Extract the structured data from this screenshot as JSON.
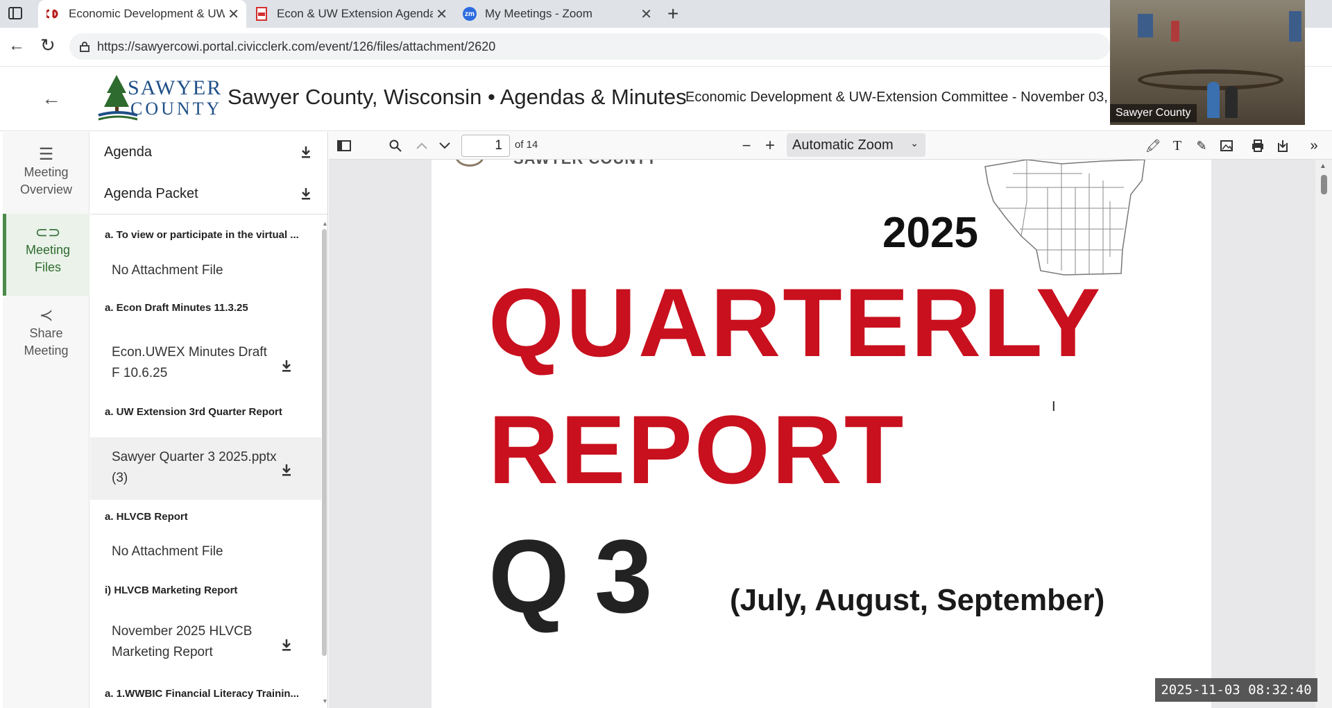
{
  "browser": {
    "tabs": [
      {
        "title": "Economic Development & UW-Ex"
      },
      {
        "title": "Econ & UW Extension Agenda Pa"
      },
      {
        "title": "My Meetings - Zoom"
      }
    ],
    "url": "https://sawyercowi.portal.civicclerk.com/event/126/files/attachment/2620"
  },
  "header": {
    "logo_line1": "SAWYER",
    "logo_line2": "COUNTY",
    "site_title": "Sawyer County, Wisconsin • Agendas & Minutes",
    "event_title": "Economic Development & UW-Extension Committee - November 03,"
  },
  "nav": {
    "meeting_overview": "Meeting Overview",
    "meeting_files": "Meeting Files",
    "share_meeting": "Share Meeting"
  },
  "files": {
    "agenda": "Agenda",
    "agenda_packet": "Agenda Packet",
    "sections": [
      {
        "title": "a. To view or participate in the virtual ...",
        "attachment": "No Attachment File"
      },
      {
        "title": "a. Econ Draft Minutes 11.3.25",
        "attachment": "Econ.UWEX Minutes Draft F 10.6.25"
      },
      {
        "title": "a. UW Extension 3rd Quarter Report",
        "attachment": "Sawyer Quarter 3 2025.pptx (3)"
      },
      {
        "title": "a. HLVCB Report",
        "attachment": "No Attachment File"
      },
      {
        "title": "i) HLVCB Marketing Report",
        "attachment": "November 2025 HLVCB Marketing Report"
      },
      {
        "title": "a. 1.WWBIC Financial Literacy Trainin..."
      }
    ]
  },
  "pdf": {
    "page_number": "1",
    "page_total": "of 14",
    "zoom": "Automatic Zoom",
    "org_text": "SAWYER COUNTY",
    "year": "2025",
    "headline1": "QUARTERLY",
    "headline2": "REPORT",
    "quarter_q": "Q",
    "quarter_num": "3",
    "months": "(July, August, September)"
  },
  "video": {
    "label": "Sawyer County",
    "timestamp": "2025-11-03 08:32:40"
  },
  "colors": {
    "accent_green": "#4a8a4a",
    "report_red": "#c8101e",
    "logo_blue": "#1f4f87"
  }
}
